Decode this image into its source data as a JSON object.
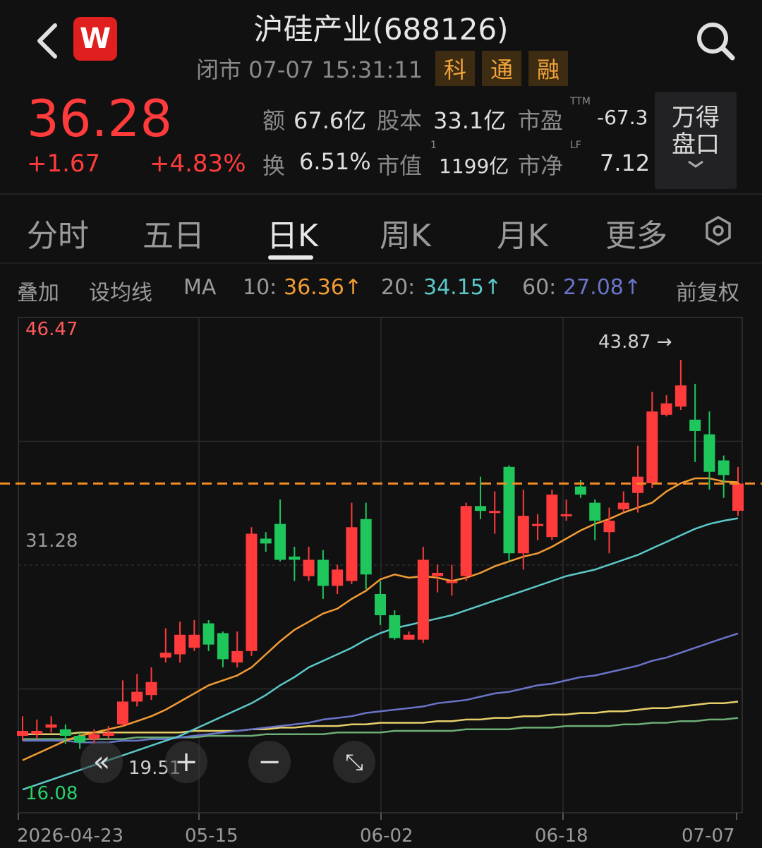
{
  "header": {
    "title": "沪硅产业(688126)",
    "status": "闭市 07-07 15:31:11",
    "tags": [
      "科",
      "通",
      "融"
    ],
    "logo_text": "W",
    "back_icon": "chevron-left-icon",
    "search_icon": "search-icon"
  },
  "quote": {
    "price": "36.28",
    "change": "+1.67",
    "change_pct": "+4.83%",
    "stats": {
      "amount_label": "额",
      "amount": "67.6亿",
      "shares_label": "股本",
      "shares": "33.1亿",
      "pe_label": "市盈",
      "pe_sup": "TTM",
      "pe": "-67.3",
      "turnover_label": "换",
      "turnover": "6.51%",
      "mcap_label": "市值",
      "mcap_sup": "1",
      "mcap": "1199亿",
      "pb_label": "市净",
      "pb_sup": "LF",
      "pb": "7.12"
    },
    "wind_button": [
      "万得",
      "盘口"
    ]
  },
  "tabs": [
    "分时",
    "五日",
    "日K",
    "周K",
    "月K",
    "更多"
  ],
  "active_tab": "日K",
  "ma_bar": {
    "overlay": "叠加",
    "set_ma": "设均线",
    "ma": "MA",
    "ma10_label": "10:",
    "ma10": "36.36↑",
    "ma20_label": "20:",
    "ma20": "34.15↑",
    "ma60_label": "60:",
    "ma60": "27.08↑",
    "adjust": "前复权"
  },
  "colors": {
    "up": "#ff3b3b",
    "down": "#1ec65c",
    "ma10": "#f39c34",
    "ma20": "#5cc8c8",
    "ma60": "#6a74c8",
    "ma120": "#e6cf6a",
    "ma250": "#6cae74",
    "accent_line": "#f38b24"
  },
  "chart_data": {
    "type": "candlestick",
    "y_top_label": "46.47",
    "y_mid_label": "31.28",
    "y_bottom_label": "16.08",
    "ylim": [
      16.08,
      46.47
    ],
    "current_price_line": 36.28,
    "high_marker": "43.87 →",
    "low_marker": "19.51",
    "x_ticks": [
      "2026-04-23",
      "05-15",
      "06-02",
      "06-18",
      "07-07"
    ],
    "candles": [
      [
        20.8,
        21.1,
        22.0,
        20.5
      ],
      [
        20.9,
        21.1,
        21.8,
        20.6
      ],
      [
        21.3,
        21.5,
        22.0,
        21.0
      ],
      [
        21.2,
        20.8,
        21.5,
        20.3
      ],
      [
        20.8,
        20.4,
        21.0,
        20.0
      ],
      [
        20.6,
        20.9,
        21.2,
        20.3
      ],
      [
        20.8,
        21.0,
        21.4,
        20.6
      ],
      [
        21.5,
        22.9,
        24.2,
        21.4
      ],
      [
        22.9,
        23.5,
        24.6,
        22.6
      ],
      [
        23.3,
        24.1,
        25.0,
        23.0
      ],
      [
        25.6,
        25.9,
        27.4,
        25.3
      ],
      [
        25.8,
        27.0,
        27.8,
        25.3
      ],
      [
        26.2,
        27.0,
        27.9,
        26.0
      ],
      [
        27.7,
        26.4,
        27.9,
        26.0
      ],
      [
        27.1,
        25.5,
        27.2,
        25.0
      ],
      [
        25.3,
        26.0,
        27.2,
        25.0
      ],
      [
        26.0,
        33.2,
        33.6,
        25.7
      ],
      [
        32.9,
        32.6,
        33.3,
        32.1
      ],
      [
        33.8,
        31.6,
        35.3,
        31.5
      ],
      [
        31.8,
        31.6,
        32.4,
        30.3
      ],
      [
        30.6,
        31.6,
        32.4,
        30.3
      ],
      [
        31.6,
        30.0,
        32.2,
        29.2
      ],
      [
        30.0,
        31.0,
        31.3,
        29.5
      ],
      [
        30.3,
        33.6,
        35.1,
        30.1
      ],
      [
        34.1,
        30.7,
        35.1,
        29.8
      ],
      [
        29.5,
        28.2,
        30.3,
        27.6
      ],
      [
        28.2,
        26.8,
        28.5,
        26.7
      ],
      [
        26.7,
        27.0,
        27.2,
        26.7
      ],
      [
        26.7,
        31.6,
        32.4,
        26.5
      ],
      [
        30.6,
        30.8,
        31.3,
        29.6
      ],
      [
        30.3,
        30.3,
        31.3,
        29.4
      ],
      [
        30.6,
        34.9,
        35.1,
        30.3
      ],
      [
        34.9,
        34.6,
        36.7,
        34.1
      ],
      [
        34.6,
        34.6,
        35.8,
        33.2
      ],
      [
        37.3,
        32.0,
        37.4,
        31.5
      ],
      [
        32.0,
        34.3,
        35.9,
        31.0
      ],
      [
        33.8,
        33.8,
        34.4,
        32.8
      ],
      [
        33.0,
        35.6,
        35.9,
        32.8
      ],
      [
        34.3,
        34.4,
        35.3,
        34.0
      ],
      [
        36.1,
        35.6,
        36.5,
        35.4
      ],
      [
        35.1,
        34.0,
        35.3,
        32.8
      ],
      [
        33.3,
        34.0,
        34.8,
        32.0
      ],
      [
        34.7,
        35.1,
        35.8,
        34.5
      ],
      [
        35.7,
        36.7,
        38.6,
        34.5
      ],
      [
        36.3,
        40.7,
        41.9,
        36.0
      ],
      [
        40.5,
        41.2,
        41.7,
        40.4
      ],
      [
        41.0,
        42.3,
        43.87,
        40.8
      ],
      [
        40.2,
        39.5,
        42.4,
        37.6
      ],
      [
        39.3,
        37.0,
        40.7,
        35.9
      ],
      [
        37.7,
        36.8,
        38.0,
        35.4
      ],
      [
        34.61,
        36.28,
        37.3,
        34.3
      ]
    ],
    "ma_lines": {
      "ma10": [
        19.3,
        19.7,
        20.1,
        20.5,
        20.8,
        21.0,
        21.2,
        21.4,
        21.7,
        22.0,
        22.4,
        22.9,
        23.4,
        23.9,
        24.2,
        24.5,
        25.0,
        25.8,
        26.6,
        27.3,
        27.8,
        28.3,
        28.6,
        29.2,
        29.7,
        30.4,
        30.7,
        30.5,
        30.6,
        30.5,
        30.3,
        30.5,
        30.8,
        31.2,
        31.5,
        31.8,
        32.0,
        32.4,
        32.9,
        33.4,
        33.8,
        34.1,
        34.5,
        34.8,
        35.1,
        35.8,
        36.3,
        36.6,
        36.6,
        36.4,
        36.36
      ],
      "ma20": [
        17.5,
        17.8,
        18.1,
        18.4,
        18.7,
        19.0,
        19.3,
        19.6,
        19.9,
        20.2,
        20.5,
        20.8,
        21.2,
        21.6,
        22.0,
        22.4,
        22.8,
        23.3,
        23.9,
        24.4,
        25.0,
        25.4,
        25.8,
        26.2,
        26.7,
        27.1,
        27.4,
        27.6,
        27.8,
        28.0,
        28.2,
        28.5,
        28.8,
        29.1,
        29.4,
        29.7,
        30.0,
        30.3,
        30.6,
        30.8,
        31.0,
        31.3,
        31.6,
        31.9,
        32.3,
        32.7,
        33.1,
        33.5,
        33.8,
        34.0,
        34.15
      ],
      "ma60": [
        20.5,
        20.5,
        20.5,
        20.5,
        20.4,
        20.4,
        20.4,
        20.5,
        20.5,
        20.6,
        20.6,
        20.7,
        20.8,
        20.9,
        21.0,
        21.1,
        21.2,
        21.3,
        21.4,
        21.5,
        21.6,
        21.8,
        21.9,
        22.0,
        22.2,
        22.3,
        22.4,
        22.5,
        22.6,
        22.8,
        22.9,
        23.0,
        23.2,
        23.4,
        23.5,
        23.7,
        23.9,
        24.0,
        24.2,
        24.4,
        24.5,
        24.7,
        24.9,
        25.1,
        25.4,
        25.6,
        25.9,
        26.2,
        26.5,
        26.8,
        27.08
      ],
      "ma120": [
        20.9,
        20.9,
        20.9,
        20.9,
        21.0,
        21.0,
        21.0,
        21.0,
        21.0,
        21.0,
        21.0,
        21.0,
        21.1,
        21.1,
        21.1,
        21.1,
        21.2,
        21.2,
        21.3,
        21.3,
        21.4,
        21.4,
        21.4,
        21.5,
        21.5,
        21.6,
        21.6,
        21.6,
        21.6,
        21.7,
        21.7,
        21.8,
        21.8,
        21.9,
        21.9,
        22.0,
        22.0,
        22.1,
        22.1,
        22.2,
        22.2,
        22.3,
        22.3,
        22.4,
        22.5,
        22.5,
        22.6,
        22.7,
        22.8,
        22.8,
        22.9
      ],
      "ma250": [
        20.6,
        20.6,
        20.6,
        20.6,
        20.6,
        20.6,
        20.6,
        20.6,
        20.7,
        20.7,
        20.7,
        20.7,
        20.7,
        20.8,
        20.8,
        20.8,
        20.8,
        20.9,
        20.9,
        20.9,
        20.9,
        20.9,
        21.0,
        21.0,
        21.0,
        21.0,
        21.1,
        21.1,
        21.1,
        21.1,
        21.1,
        21.2,
        21.2,
        21.2,
        21.2,
        21.3,
        21.3,
        21.3,
        21.4,
        21.4,
        21.4,
        21.4,
        21.5,
        21.5,
        21.6,
        21.6,
        21.7,
        21.7,
        21.8,
        21.8,
        21.9
      ]
    }
  },
  "controls": [
    "«",
    "+",
    "−",
    "⤡"
  ]
}
